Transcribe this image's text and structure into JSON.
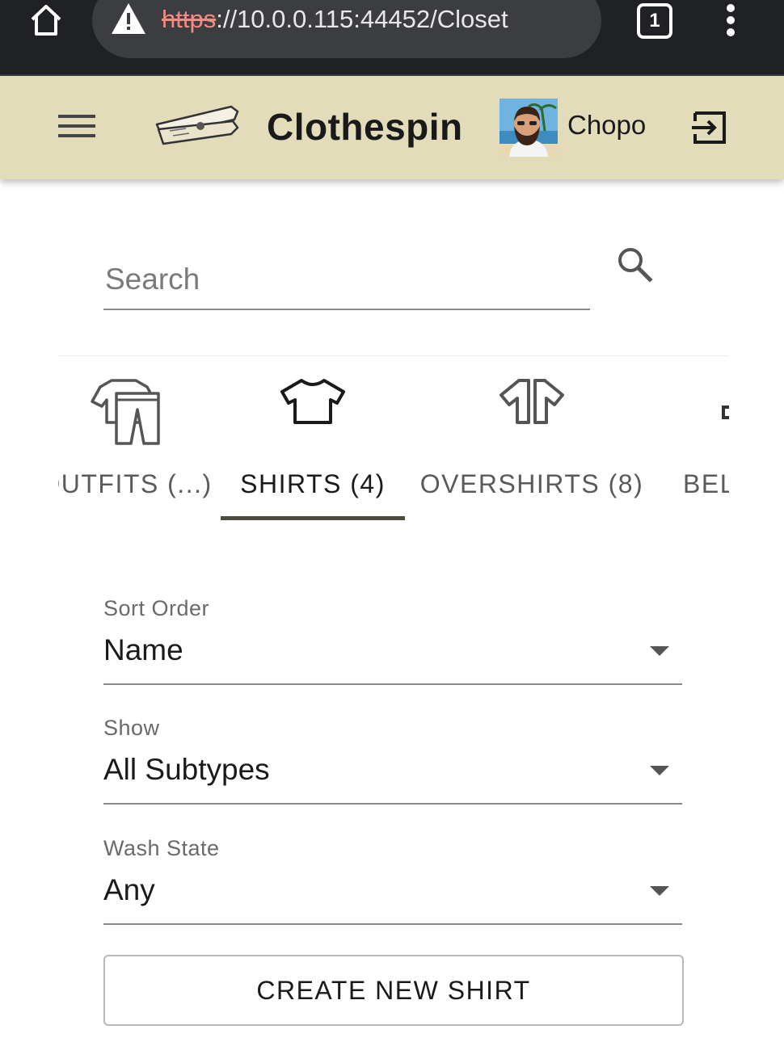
{
  "browser": {
    "url_scheme": "https",
    "url_rest": "://10.0.0.115:44452/Closet",
    "tab_count": "1"
  },
  "header": {
    "title": "Clothespin",
    "username": "Chopo",
    "background_color": "#e3dcba"
  },
  "search": {
    "placeholder": "Search",
    "value": ""
  },
  "categories": {
    "tabs": [
      {
        "label": "OUTFITS (...)",
        "icon": "outfit-icon",
        "active": false
      },
      {
        "label": "SHIRTS (4)",
        "icon": "shirt-icon",
        "active": true
      },
      {
        "label": "OVERSHIRTS (8)",
        "icon": "overshirt-icon",
        "active": false
      },
      {
        "label": "BELTS",
        "icon": "belt-icon",
        "active": false
      }
    ],
    "indicator_color": "#4d4a3e"
  },
  "filters": {
    "sort_order": {
      "label": "Sort Order",
      "value": "Name"
    },
    "show": {
      "label": "Show",
      "value": "All Subtypes"
    },
    "wash_state": {
      "label": "Wash State",
      "value": "Any"
    }
  },
  "actions": {
    "create_label": "CREATE NEW SHIRT"
  }
}
